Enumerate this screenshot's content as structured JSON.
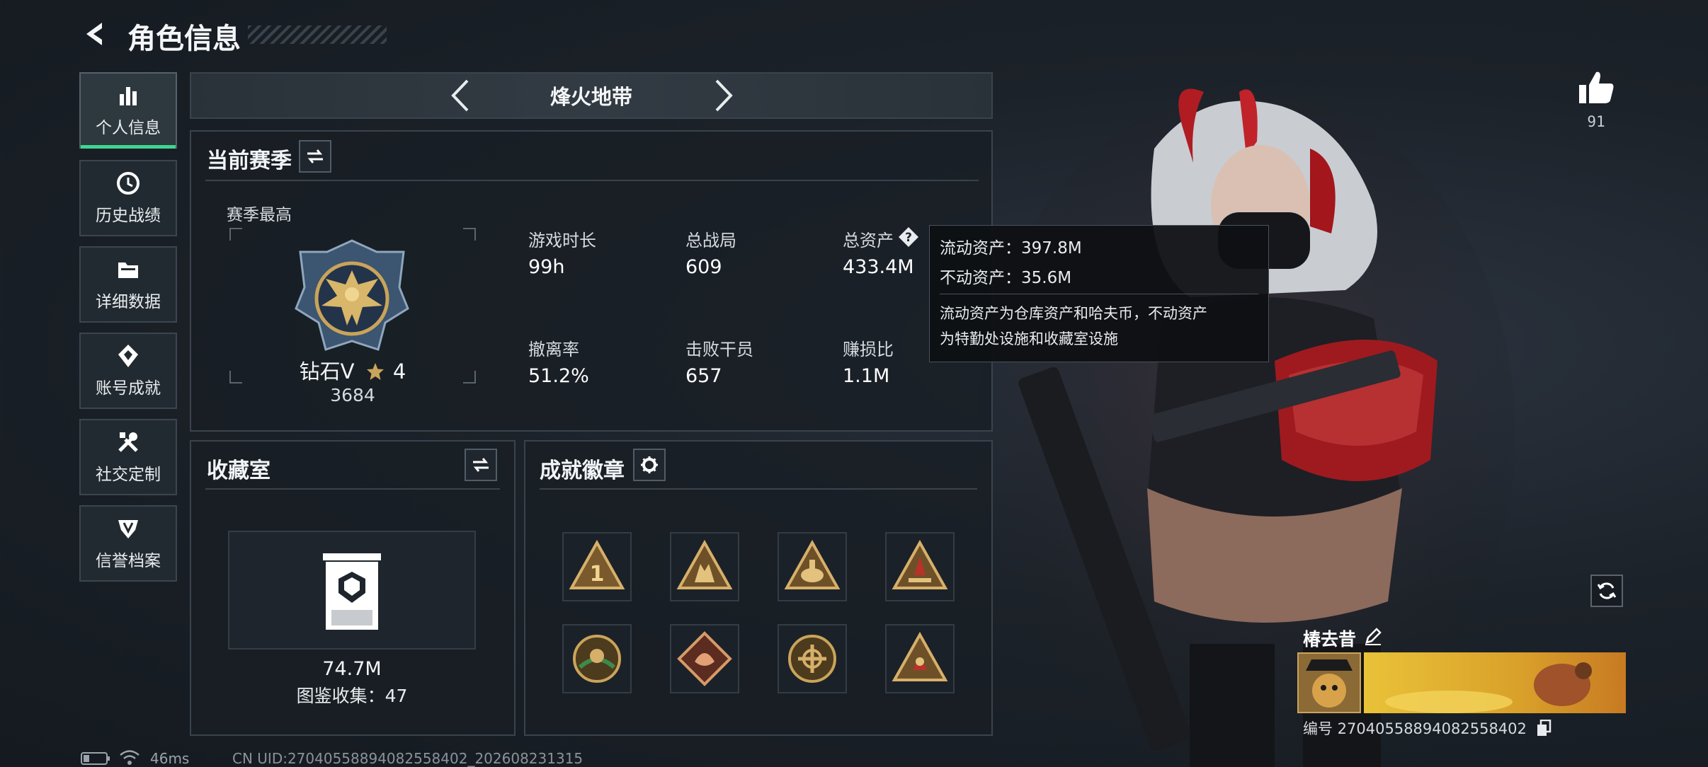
{
  "header": {
    "title": "角色信息"
  },
  "sidebar": {
    "items": [
      {
        "label": "个人信息",
        "icon": "bar-chart-icon",
        "active": true
      },
      {
        "label": "历史战绩",
        "icon": "history-icon"
      },
      {
        "label": "详细数据",
        "icon": "folder-icon"
      },
      {
        "label": "账号成就",
        "icon": "achievement-icon"
      },
      {
        "label": "社交定制",
        "icon": "tools-icon"
      },
      {
        "label": "信誉档案",
        "icon": "shield-icon"
      }
    ]
  },
  "mode_selector": {
    "label": "烽火地带"
  },
  "season": {
    "title": "当前赛季",
    "best_label": "赛季最高",
    "rank_name": "钻石V",
    "rank_stars": "4",
    "rank_score": "3684",
    "stats": [
      {
        "label": "游戏时长",
        "value": "99h"
      },
      {
        "label": "总战局",
        "value": "609"
      },
      {
        "label": "总资产",
        "value": "433.4M"
      },
      {
        "label": "撤离率",
        "value": "51.2%"
      },
      {
        "label": "击败干员",
        "value": "657"
      },
      {
        "label": "赚损比",
        "value": "1.1M"
      }
    ]
  },
  "tooltip": {
    "line1": "流动资产：397.8M",
    "line2": "不动资产：35.6M",
    "desc_line1": "流动资产为仓库资产和哈夫币，不动资产",
    "desc_line2": "为特勤处设施和收藏室设施"
  },
  "collection": {
    "title": "收藏室",
    "value": "74.7M",
    "catalog": "图鉴收集：47"
  },
  "achievements": {
    "title": "成就徽章",
    "badges": [
      "badge-1-icon",
      "badge-2-icon",
      "badge-3-icon",
      "badge-4-icon",
      "badge-5-icon",
      "badge-6-icon",
      "badge-7-icon",
      "badge-8-icon"
    ]
  },
  "likes": {
    "count": "91"
  },
  "player": {
    "name": "椿去昔",
    "id_text": "编号 2704055889408255840​2"
  },
  "status_bar": {
    "ping": "46ms",
    "uid": "CN UID:2704055889408255840​2_202608231315"
  },
  "colors": {
    "accent": "#3fd58e",
    "gold": "#c9a45a"
  }
}
